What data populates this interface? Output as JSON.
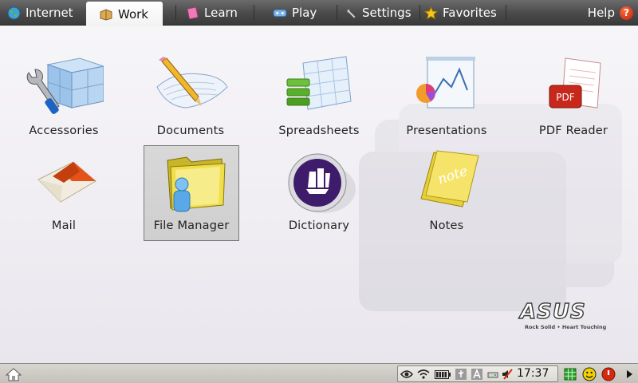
{
  "tabs": [
    {
      "label": "Internet",
      "icon": "globe-icon",
      "active": false
    },
    {
      "label": "Work",
      "icon": "briefcase-icon",
      "active": true
    },
    {
      "label": "Learn",
      "icon": "book-icon",
      "active": false
    },
    {
      "label": "Play",
      "icon": "joystick-icon",
      "active": false
    },
    {
      "label": "Settings",
      "icon": "wrench-icon",
      "active": false
    },
    {
      "label": "Favorites",
      "icon": "star-icon",
      "active": false
    }
  ],
  "help": {
    "label": "Help",
    "badge": "?"
  },
  "apps": [
    {
      "label": "Accessories",
      "icon": "accessories-icon"
    },
    {
      "label": "Documents",
      "icon": "documents-icon"
    },
    {
      "label": "Spreadsheets",
      "icon": "spreadsheets-icon"
    },
    {
      "label": "Presentations",
      "icon": "presentations-icon"
    },
    {
      "label": "PDF Reader",
      "icon": "pdf-reader-icon",
      "icon_text": "PDF"
    },
    {
      "label": "Mail",
      "icon": "mail-icon"
    },
    {
      "label": "File Manager",
      "icon": "file-manager-icon",
      "selected": true
    },
    {
      "label": "Dictionary",
      "icon": "dictionary-icon"
    },
    {
      "label": "Notes",
      "icon": "notes-icon",
      "icon_text": "note"
    }
  ],
  "logo": {
    "wordmark": "ASUS",
    "tagline": "Rock Solid • Heart Touching"
  },
  "taskbar": {
    "clock": "17:37",
    "tray_icons": [
      "network-eye-icon",
      "wifi-icon",
      "battery-icon",
      "usb-icon",
      "keyboard-a-icon",
      "drive-icon",
      "volume-muted-icon"
    ],
    "right_icons": [
      "grid-icon",
      "smiley-icon",
      "power-icon",
      "arrow-right-icon"
    ],
    "colors": {
      "power": "#d42a10",
      "grid": "#2aa32a",
      "smiley": "#f2d200"
    }
  },
  "colors": {
    "tabbar": "#4c4c4c",
    "accent_orange": "#d45a12"
  }
}
